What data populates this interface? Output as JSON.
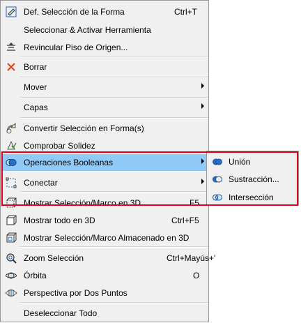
{
  "menu": {
    "items": [
      {
        "label": "Def. Selección de la Forma",
        "shortcut": "Ctrl+T",
        "icon": "shape-selection-icon"
      },
      {
        "label": "Seleccionar & Activar Herramienta",
        "shortcut": "",
        "icon": ""
      },
      {
        "label": "Revincular Piso de Origen...",
        "shortcut": "",
        "icon": "relink-floor-icon"
      },
      {
        "label": "Borrar",
        "shortcut": "",
        "icon": "delete-x-icon"
      },
      {
        "label": "Mover",
        "shortcut": "",
        "icon": "",
        "submenu": true
      },
      {
        "label": "Capas",
        "shortcut": "",
        "icon": "",
        "submenu": true
      },
      {
        "label": "Convertir Selección en Forma(s)",
        "shortcut": "",
        "icon": "convert-to-shape-icon"
      },
      {
        "label": "Comprobar Solidez",
        "shortcut": "",
        "icon": "check-solid-icon"
      },
      {
        "label": "Operaciones Booleanas",
        "shortcut": "",
        "icon": "boolean-operations-icon",
        "submenu": true
      },
      {
        "label": "Conectar",
        "shortcut": "",
        "icon": "connect-icon",
        "submenu": true
      },
      {
        "label": "Mostrar Selección/Marco en 3D",
        "shortcut": "F5",
        "icon": "show-selection-3d-icon"
      },
      {
        "label": "Mostrar todo en 3D",
        "shortcut": "Ctrl+F5",
        "icon": "show-all-3d-icon"
      },
      {
        "label": "Mostrar Selección/Marco Almacenado en 3D",
        "shortcut": "",
        "icon": "show-stored-3d-icon"
      },
      {
        "label": "Zoom Selección",
        "shortcut": "Ctrl+Mayús+'",
        "icon": "zoom-selection-icon"
      },
      {
        "label": "Órbita",
        "shortcut": "O",
        "icon": "orbit-icon"
      },
      {
        "label": "Perspectiva por Dos Puntos",
        "shortcut": "",
        "icon": "two-point-perspective-icon"
      },
      {
        "label": "Deseleccionar Todo",
        "shortcut": "",
        "icon": ""
      }
    ]
  },
  "submenu": {
    "items": [
      {
        "label": "Unión",
        "icon": "union-icon"
      },
      {
        "label": "Sustracción...",
        "icon": "subtraction-icon"
      },
      {
        "label": "Intersección",
        "icon": "intersection-icon"
      }
    ]
  },
  "colors": {
    "highlight": "#91c9f7",
    "annotation_border": "#e0001b",
    "menu_bg": "#f0f0f0"
  }
}
